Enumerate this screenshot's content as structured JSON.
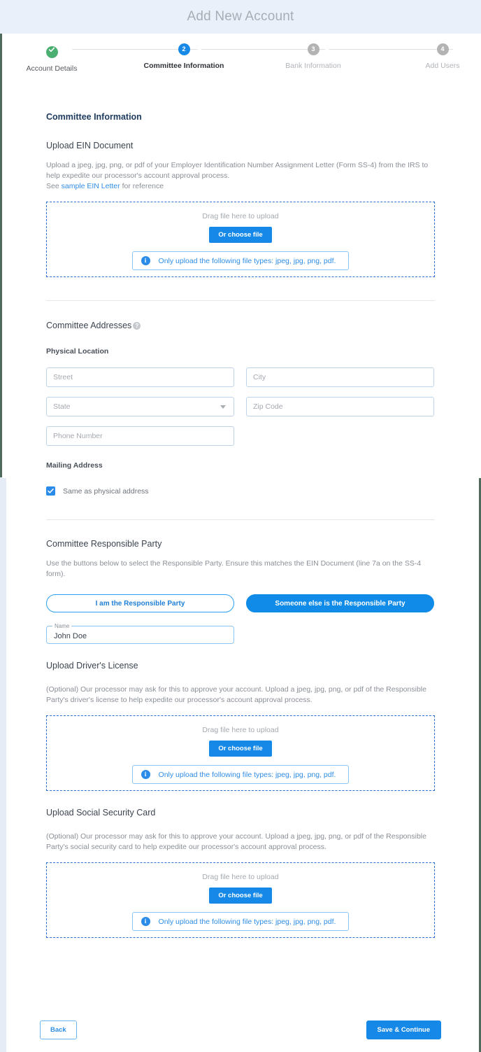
{
  "header": {
    "title": "Add New Account"
  },
  "stepper": {
    "steps": [
      {
        "number": "1",
        "label": "Account Details",
        "state": "done",
        "icon": "check-icon"
      },
      {
        "number": "2",
        "label": "Committee Information",
        "state": "active",
        "icon": ""
      },
      {
        "number": "3",
        "label": "Bank Information",
        "state": "todo",
        "icon": ""
      },
      {
        "number": "4",
        "label": "Add Users",
        "state": "todo",
        "icon": ""
      }
    ]
  },
  "main": {
    "section_heading": "Committee Information",
    "ein": {
      "title": "Upload EIN Document",
      "desc_before": "Upload a jpeg, jpg, png, or pdf of your Employer Identification Number Assignment Letter (Form SS-4) from the IRS to help expedite our processor's account approval process.",
      "see_prefix": "See ",
      "link_text": "sample EIN Letter",
      "see_suffix": " for reference"
    },
    "dropzone": {
      "drag_text": "Drag file here to upload",
      "choose_label": "Or choose file",
      "note_text": "Only upload the following file types: jpeg, jpg, png, pdf.",
      "info_glyph": "i"
    },
    "addresses": {
      "title": "Committee Addresses",
      "help_glyph": "?",
      "physical_label": "Physical Location",
      "fields": {
        "street": "Street",
        "city": "City",
        "state": "State",
        "zip": "Zip Code",
        "phone": "Phone Number"
      },
      "mailing_label": "Mailing Address",
      "same_as_physical": "Same as physical address"
    },
    "responsible_party": {
      "title": "Committee Responsible Party",
      "desc": "Use the buttons below to select the Responsible Party. Ensure this matches the EIN Document (line 7a on the SS-4 form).",
      "btn_self": "I am the Responsible Party",
      "btn_other": "Someone else is the Responsible Party",
      "name_legend": "Name",
      "name_value": "John Doe"
    },
    "drivers_license": {
      "title": "Upload Driver's License",
      "desc": "(Optional) Our processor may ask for this to approve your account. Upload a jpeg, jpg, png, or pdf of the Responsible Party's driver's license to help expedite our processor's account approval process."
    },
    "social_security": {
      "title": "Upload Social Security Card",
      "desc": "(Optional) Our processor may ask for this to approve your account. Upload a jpeg, jpg, png, or pdf of the Responsible Party's social security card to help expedite our processor's account approval process."
    }
  },
  "footer": {
    "back_label": "Back",
    "save_label": "Save & Continue"
  },
  "colors": {
    "accent_blue": "#1689e8",
    "link_blue": "#2f8de4",
    "done_green": "#4caf72",
    "todo_gray": "#b3b3b3",
    "header_band": "#eaf0fa"
  }
}
